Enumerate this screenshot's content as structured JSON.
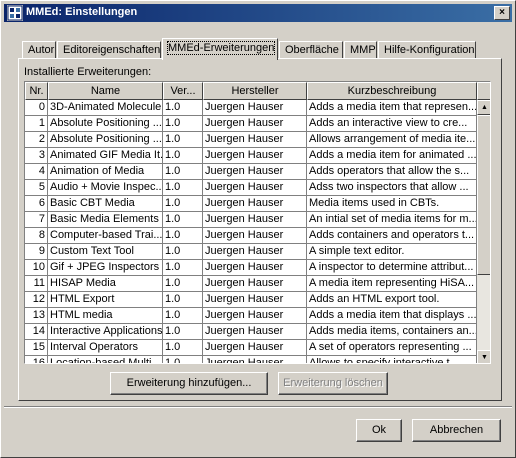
{
  "window": {
    "title": "MMEd: Einstellungen",
    "close_glyph": "×"
  },
  "tabs": [
    {
      "label": "Autor",
      "active": false
    },
    {
      "label": "Editoreigenschaften",
      "active": false
    },
    {
      "label": "MMEd-Erweiterungen",
      "active": true
    },
    {
      "label": "Oberfläche",
      "active": false
    },
    {
      "label": "MMP",
      "active": false
    },
    {
      "label": "Hilfe-Konfiguration",
      "active": false
    }
  ],
  "section_label": "Installierte Erweiterungen:",
  "table": {
    "columns": [
      "Nr.",
      "Name",
      "Ver...",
      "Hersteller",
      "Kurzbeschreibung"
    ],
    "rows": [
      [
        "0",
        "3D-Animated Molecule",
        "1.0",
        "Juergen Hauser",
        "Adds a media item that represen..."
      ],
      [
        "1",
        "Absolute Positioning ...",
        "1.0",
        "Juergen Hauser",
        "Adds an interactive view to cre..."
      ],
      [
        "2",
        "Absolute Positioning ...",
        "1.0",
        "Juergen Hauser",
        "Allows arrangement of media ite..."
      ],
      [
        "3",
        "Animated GIF Media It...",
        "1.0",
        "Juergen Hauser",
        "Adds a media item for animated ..."
      ],
      [
        "4",
        "Animation of Media",
        "1.0",
        "Juergen Hauser",
        "Adds operators that allow the s..."
      ],
      [
        "5",
        "Audio + Movie Inspec...",
        "1.0",
        "Juergen Hauser",
        "Adss two inspectors that allow ..."
      ],
      [
        "6",
        "Basic CBT Media",
        "1.0",
        "Juergen Hauser",
        "Media items used in CBTs."
      ],
      [
        "7",
        "Basic Media Elements",
        "1.0",
        "Juergen Hauser",
        "An intial set of media items for m..."
      ],
      [
        "8",
        "Computer-based Trai...",
        "1.0",
        "Juergen Hauser",
        "Adds containers and operators t..."
      ],
      [
        "9",
        "Custom Text Tool",
        "1.0",
        "Juergen Hauser",
        "A simple text editor."
      ],
      [
        "10",
        "Gif + JPEG Inspectors",
        "1.0",
        "Juergen Hauser",
        "A inspector to determine attribut..."
      ],
      [
        "11",
        "HISAP Media",
        "1.0",
        "Juergen Hauser",
        "A media item representing HiSA..."
      ],
      [
        "12",
        "HTML Export",
        "1.0",
        "Juergen Hauser",
        "Adds an HTML export tool."
      ],
      [
        "13",
        "HTML media",
        "1.0",
        "Juergen Hauser",
        "Adds a media item that displays ..."
      ],
      [
        "14",
        "Interactive Applications",
        "1.0",
        "Juergen Hauser",
        "Adds media items, containers an..."
      ],
      [
        "15",
        "Interval Operators",
        "1.0",
        "Juergen Hauser",
        "A set of operators representing ..."
      ],
      [
        "16",
        "Location-based Multi...",
        "1.0",
        "Juergen Hauser",
        "Allows to specify interactive t..."
      ]
    ]
  },
  "scrollbar": {
    "up_glyph": "▲",
    "down_glyph": "▼"
  },
  "buttons": {
    "add_extension": "Erweiterung hinzufügen...",
    "delete_extension": "Erweiterung löschen",
    "ok": "Ok",
    "cancel": "Abbrechen"
  }
}
